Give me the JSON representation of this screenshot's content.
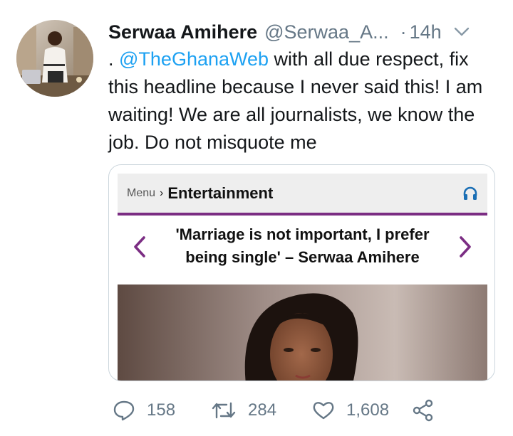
{
  "tweet": {
    "author_name": "Serwaa Amihere",
    "author_handle": "@Serwaa_A...",
    "separator": "·",
    "time": "14h",
    "text_prefix": ". ",
    "mention": "@TheGhanaWeb",
    "text_body": " with all due respect, fix this headline because I never said this! I am waiting! We are all journalists, we know the job. Do not misquote me"
  },
  "card": {
    "menu_label": "Menu",
    "menu_separator": "›",
    "section": "Entertainment",
    "headline": "'Marriage is not important, I prefer being single' – Serwaa Amihere"
  },
  "actions": {
    "replies": "158",
    "retweets": "284",
    "likes": "1,608"
  },
  "colors": {
    "mention": "#1da1f2",
    "muted": "#657786",
    "site_accent": "#7b2d83",
    "headphone_icon": "#1a6fb5"
  },
  "icons": [
    "chevron-down-icon",
    "headphones-icon",
    "arrow-left-icon",
    "arrow-right-icon",
    "reply-icon",
    "retweet-icon",
    "like-icon",
    "share-icon"
  ]
}
